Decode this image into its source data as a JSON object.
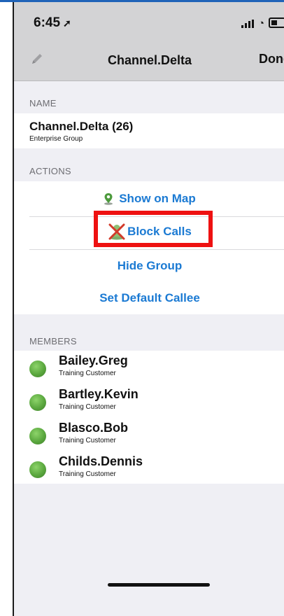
{
  "status_bar": {
    "time": "6:45",
    "location_arrow": "➚"
  },
  "nav": {
    "title": "Channel.Delta",
    "done_label": "Done"
  },
  "name_section": {
    "header": "NAME",
    "title": "Channel.Delta (26)",
    "subtitle": "Enterprise Group"
  },
  "actions_section": {
    "header": "ACTIONS",
    "show_on_map": "Show on Map",
    "block_calls": "Block Calls",
    "hide_group": "Hide Group",
    "set_default_callee": "Set Default Callee"
  },
  "members_section": {
    "header": "MEMBERS",
    "members": [
      {
        "name": "Bailey.Greg",
        "subtitle": "Training Customer",
        "status_color": "#5aa73e"
      },
      {
        "name": "Bartley.Kevin",
        "subtitle": "Training Customer",
        "status_color": "#5aa73e"
      },
      {
        "name": "Blasco.Bob",
        "subtitle": "Training Customer",
        "status_color": "#5aa73e"
      },
      {
        "name": "Childs.Dennis",
        "subtitle": "Training Customer",
        "status_color": "#5aa73e"
      }
    ]
  },
  "colors": {
    "accent_blue": "#1b7ad3",
    "highlight_red": "#ee1111",
    "nav_gray": "#d3d3d5"
  },
  "icons": [
    "pencil-icon",
    "map-pin-icon",
    "block-calls-icon",
    "location-arrow-icon",
    "signal-icon",
    "wifi-icon",
    "battery-icon"
  ]
}
